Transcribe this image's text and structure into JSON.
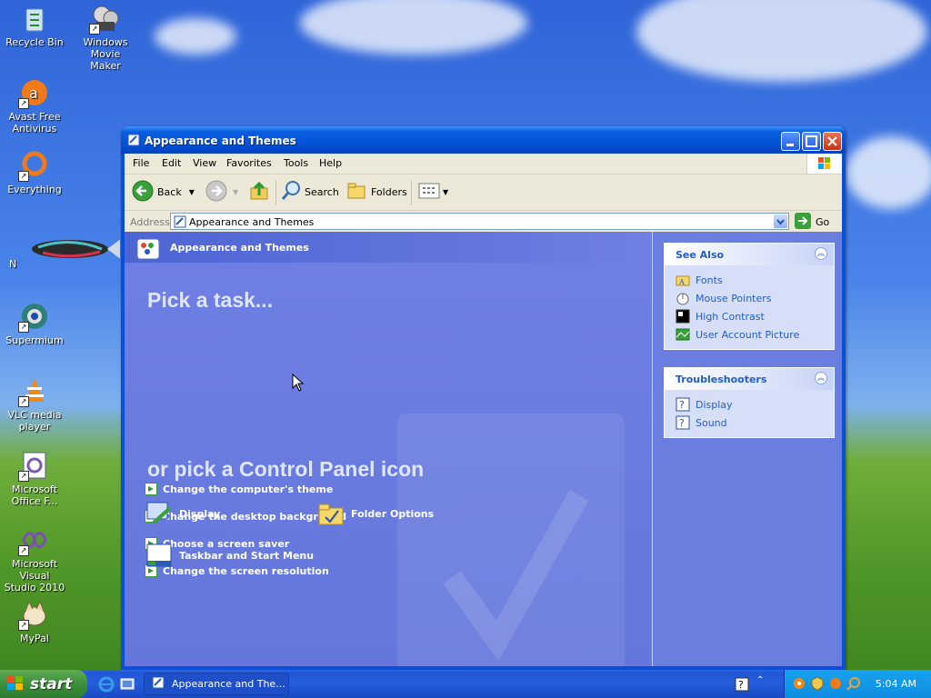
{
  "desktop": {
    "icons": [
      {
        "label": "Recycle Bin",
        "icon": "recycle-bin-icon"
      },
      {
        "label": "Windows Movie\nMaker",
        "icon": "movie-maker-icon"
      },
      {
        "label": "Avast Free\nAntivirus",
        "icon": "avast-icon"
      },
      {
        "label": "Everything",
        "icon": "everything-icon"
      },
      {
        "label": "N",
        "icon": "fish-icon"
      },
      {
        "label": "Supermium",
        "icon": "supermium-icon"
      },
      {
        "label": "VLC media\nplayer",
        "icon": "vlc-icon"
      },
      {
        "label": "Microsoft\nOffice F...",
        "icon": "office-icon"
      },
      {
        "label": "Microsoft Visual\nStudio 2010",
        "icon": "visual-studio-icon"
      },
      {
        "label": "MyPal",
        "icon": "mypal-icon"
      }
    ]
  },
  "window": {
    "title": "Appearance and Themes",
    "menu": [
      "File",
      "Edit",
      "View",
      "Favorites",
      "Tools",
      "Help"
    ],
    "toolbar": {
      "back": "Back",
      "search": "Search",
      "folders": "Folders"
    },
    "address": {
      "label": "Address",
      "value": "Appearance and Themes",
      "go": "Go"
    }
  },
  "main": {
    "header": "Appearance and Themes",
    "pick_task": "Pick a task...",
    "tasks": [
      "Change the computer's theme",
      "Change the desktop background",
      "Choose a screen saver",
      "Change the screen resolution"
    ],
    "pick_icon": "or pick a Control Panel icon",
    "icons": [
      {
        "label": "Display",
        "icon": "display-icon"
      },
      {
        "label": "Folder Options",
        "icon": "folder-options-icon"
      },
      {
        "label": "Taskbar and Start Menu",
        "icon": "taskbar-icon"
      }
    ]
  },
  "sidebar": {
    "see_also": {
      "title": "See Also",
      "items": [
        {
          "label": "Fonts",
          "icon": "fonts-folder-icon"
        },
        {
          "label": "Mouse Pointers",
          "icon": "mouse-icon"
        },
        {
          "label": "High Contrast",
          "icon": "contrast-icon"
        },
        {
          "label": "User Account Picture",
          "icon": "user-picture-icon"
        }
      ]
    },
    "troubleshooters": {
      "title": "Troubleshooters",
      "items": [
        {
          "label": "Display",
          "icon": "help-icon"
        },
        {
          "label": "Sound",
          "icon": "help-icon"
        }
      ]
    }
  },
  "taskbar": {
    "start": "start",
    "task_button": "Appearance and The...",
    "clock": "5:04 AM"
  },
  "colors": {
    "title_blue": "#0553d7",
    "panel_blue": "#6a7ee0",
    "link_blue": "#215dc6",
    "start_green": "#3c8f3b"
  }
}
